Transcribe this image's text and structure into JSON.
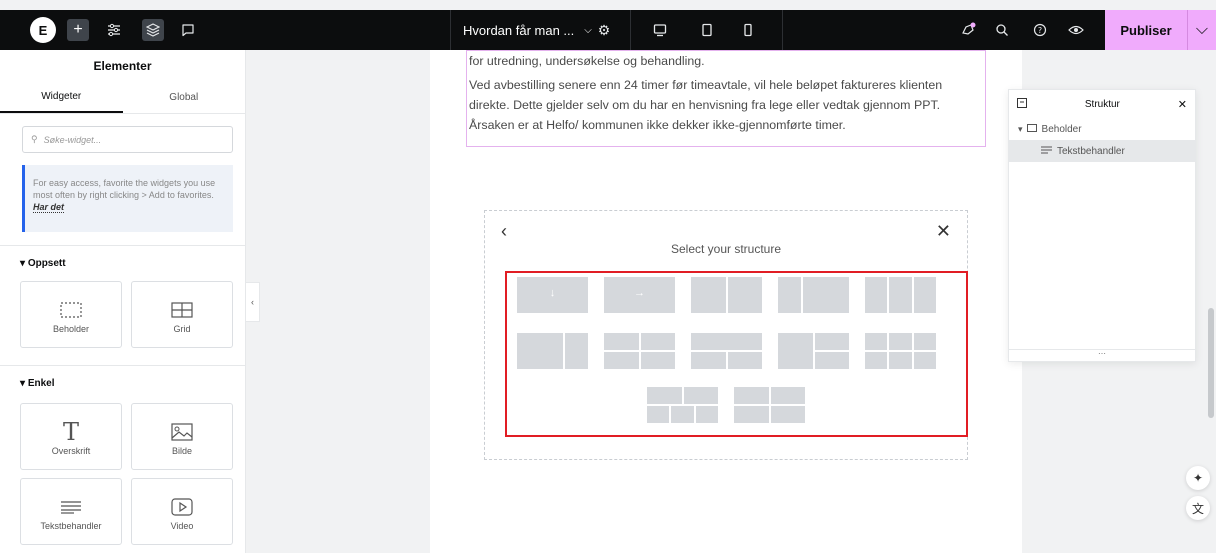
{
  "topbar": {
    "logo_text": "E",
    "add_icon": "plus-icon",
    "settings_icon": "sliders-icon",
    "layers_icon": "layers-icon",
    "comments_icon": "comment-icon",
    "doc_title": "Hvordan får man ...",
    "page_settings_icon": "gear-icon",
    "device_icons": [
      "desktop-icon",
      "tablet-icon",
      "mobile-icon"
    ],
    "publish_label": "Publiser",
    "accent": "#f0abfc"
  },
  "panel": {
    "title": "Elementer",
    "tabs": [
      "Widgeter",
      "Global"
    ],
    "search_placeholder": "Søke-widget...",
    "tip_text": "For easy access, favorite the widgets you use most often by right clicking > Add to favorites.",
    "tip_link": "Har det",
    "sections": [
      {
        "title": "Oppsett",
        "widgets": [
          "Beholder",
          "Grid"
        ]
      },
      {
        "title": "Enkel",
        "widgets": [
          "Overskrift",
          "Bilde",
          "Tekstbehandler",
          "Video"
        ]
      }
    ]
  },
  "canvas": {
    "paragraph_partial": "for utredning, undersøkelse og behandling.",
    "paragraph2": "Ved avbestilling senere enn 24 timer før timeavtale, vil hele beløpet faktureres klienten direkte. Dette gjelder selv om du har en henvisning fra lege eller vedtak gjennom PPT. Årsaken er at Helfo/ kommunen ikke dekker ikke-gjennomførte timer.",
    "structure_picker_title": "Select your structure"
  },
  "structure_panel": {
    "title": "Struktur",
    "items": [
      "Beholder",
      "Tekstbehandler"
    ]
  }
}
